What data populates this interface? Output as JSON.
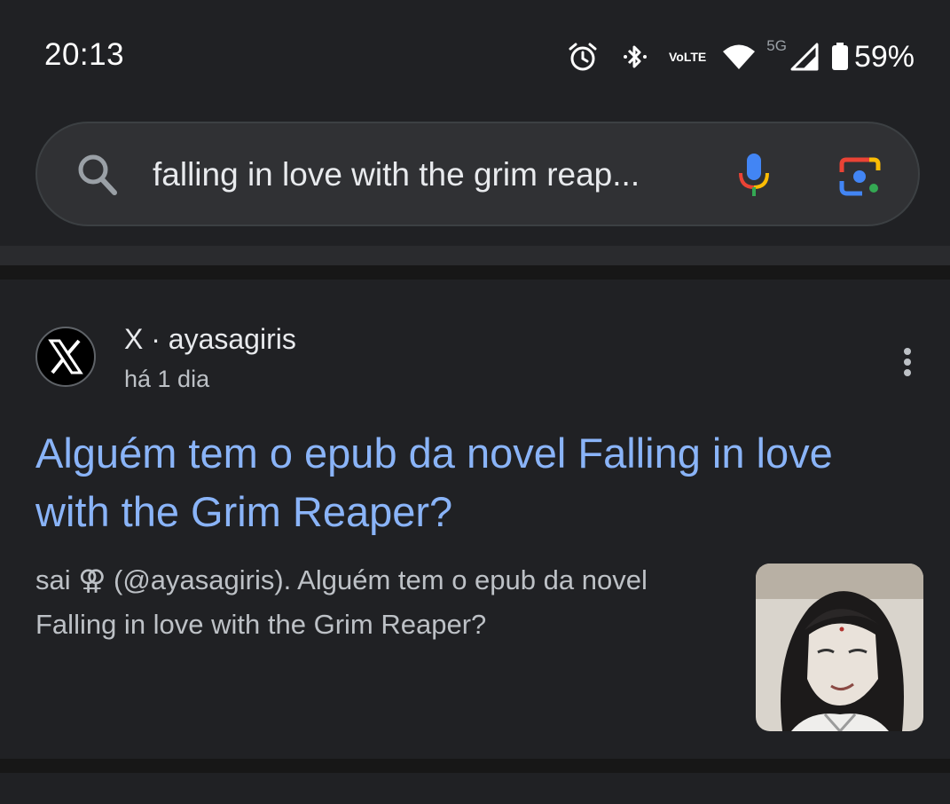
{
  "status_bar": {
    "time": "20:13",
    "volte_top": "Vo",
    "volte_bottom": "LTE",
    "network": "5G",
    "battery": "59%",
    "icons": [
      "alarm-icon",
      "bluetooth-icon",
      "volte-icon",
      "wifi-icon",
      "signal-icon",
      "battery-icon"
    ]
  },
  "search": {
    "query": "falling in love with the grim reap...",
    "icons": [
      "search-icon",
      "mic-icon",
      "lens-icon"
    ]
  },
  "result": {
    "site": "X · ayasagiris",
    "date": "há 1 dia",
    "title": "Alguém tem o epub da novel Falling in love with the Grim Reaper?",
    "snippet": "sai ⚢ (@ayasagiris). Alguém tem o epub da novel Falling in love with the Grim Reaper?",
    "icons": [
      "x-logo-icon",
      "more-vert-icon"
    ]
  },
  "colors": {
    "background": "#202124",
    "search_box": "#303134",
    "link": "#8ab4f8",
    "snippet": "#bdc1c6"
  }
}
